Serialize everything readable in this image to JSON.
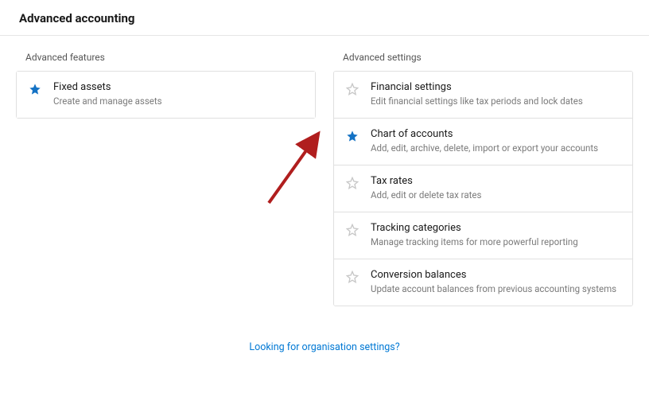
{
  "page_title": "Advanced accounting",
  "features": {
    "title": "Advanced features",
    "items": [
      {
        "title": "Fixed assets",
        "desc": "Create and manage assets",
        "starred": true
      }
    ]
  },
  "settings": {
    "title": "Advanced settings",
    "items": [
      {
        "title": "Financial settings",
        "desc": "Edit financial settings like tax periods and lock dates",
        "starred": false
      },
      {
        "title": "Chart of accounts",
        "desc": "Add, edit, archive, delete, import or export your accounts",
        "starred": true
      },
      {
        "title": "Tax rates",
        "desc": "Add, edit or delete tax rates",
        "starred": false
      },
      {
        "title": "Tracking categories",
        "desc": "Manage tracking items for more powerful reporting",
        "starred": false
      },
      {
        "title": "Conversion balances",
        "desc": "Update account balances from previous accounting systems",
        "starred": false
      }
    ]
  },
  "footer_link": "Looking for organisation settings?",
  "colors": {
    "star_filled": "#1472c4",
    "star_empty": "#c7c7c7",
    "link": "#0078d4",
    "arrow": "#b01e1e"
  }
}
